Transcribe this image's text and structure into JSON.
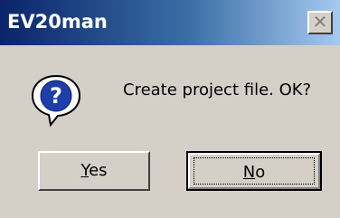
{
  "window": {
    "title": "EV20man",
    "close_glyph": "✕"
  },
  "dialog": {
    "icon": "question-icon",
    "icon_glyph": "?",
    "message": "Create project file. OK?"
  },
  "buttons": {
    "yes": {
      "accel": "Y",
      "rest": "es"
    },
    "no": {
      "accel": "N",
      "rest": "o"
    }
  },
  "colors": {
    "title_gradient_start": "#0a246a",
    "title_gradient_end": "#a6caf0",
    "dialog_background": "#d4d0c8",
    "icon_fill": "#1f3fa8"
  }
}
